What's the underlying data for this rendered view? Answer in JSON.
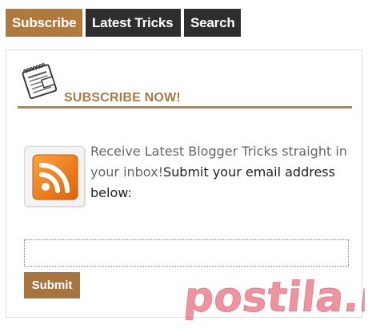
{
  "tabs": [
    {
      "label": "Subscribe",
      "active": true
    },
    {
      "label": "Latest Tricks",
      "active": false
    },
    {
      "label": "Search",
      "active": false
    }
  ],
  "widget": {
    "heading": "SUBSCRIBE NOW!",
    "heading_icon": "newspaper-feed-icon",
    "rss_icon": "rss-feed-icon",
    "description_part1": "Receive Latest Blogger Tricks straight in your inbox!",
    "description_part2": "Submit your email address below:",
    "email_value": "",
    "email_placeholder": "",
    "submit_label": "Submit"
  },
  "watermark": {
    "text": "postila.ru"
  },
  "colors": {
    "accent": "#b07a3e",
    "tab_dark": "#2e2e2e",
    "heading_text": "#a87a48",
    "rss_orange": "#f07a12",
    "watermark": "#e03a52"
  }
}
